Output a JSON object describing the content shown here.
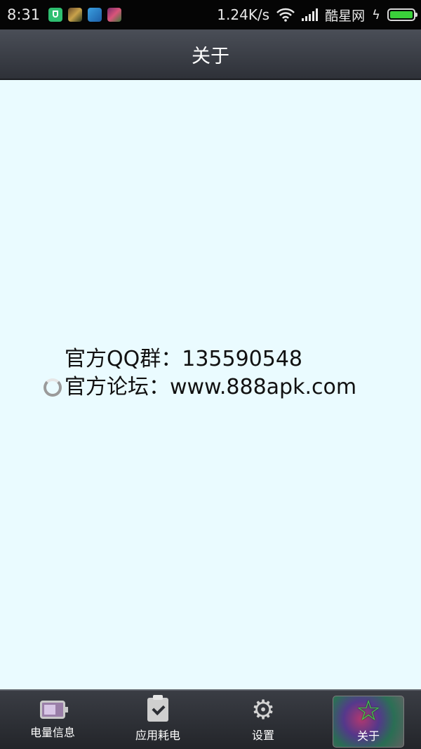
{
  "status_bar": {
    "time": "8:31",
    "speed": "1.24K/s",
    "carrier": "酷星网",
    "colors": {
      "battery": "#3ad13a"
    }
  },
  "title_bar": {
    "title": "关于"
  },
  "content": {
    "qq_group": "官方QQ群：135590548",
    "forum": "官方论坛：www.888apk.com"
  },
  "tabs": [
    {
      "label": "电量信息",
      "icon": "battery-icon"
    },
    {
      "label": "应用耗电",
      "icon": "clipboard-check-icon"
    },
    {
      "label": "设置",
      "icon": "gear-icon"
    },
    {
      "label": "关于",
      "icon": "star-icon",
      "active": true
    }
  ],
  "colors": {
    "content_bg": "#eafbff",
    "title_bar_bg": "#3a3d44",
    "active_star": "#46d04a"
  }
}
